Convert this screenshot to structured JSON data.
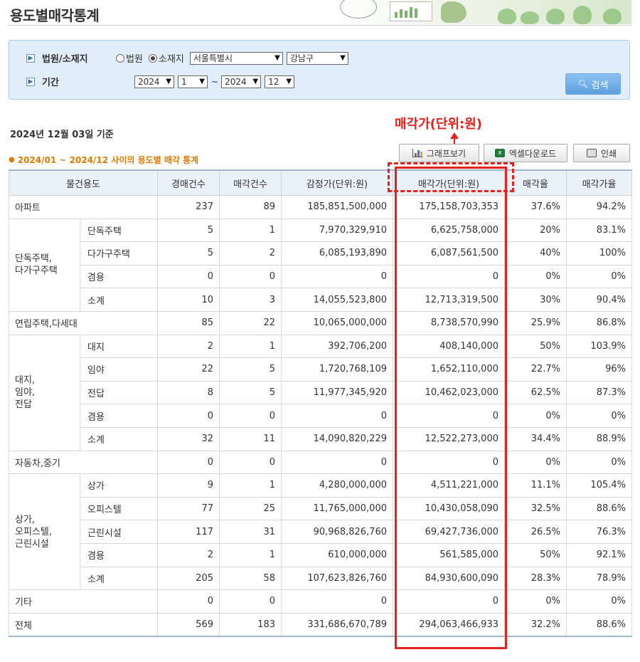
{
  "page": {
    "title": "용도별매각통계"
  },
  "search": {
    "court_label": "법원/소재지",
    "period_label": "기간",
    "radio_court": "법원",
    "radio_location": "소재지",
    "selected_radio": "소재지",
    "city_select": "서울특별시",
    "district_select": "강남구",
    "from_year": "2024",
    "from_month": "1",
    "tilde": "~",
    "to_year": "2024",
    "to_month": "12",
    "search_button": "검색"
  },
  "info": {
    "base_date": "2024년 12월 03일 기준",
    "period_title": "2024/01 ~ 2024/12 사이의 용도별 매각 통계"
  },
  "toolbar": {
    "graph_button": "그래프보기",
    "excel_button": "엑셀다운로드",
    "print_button": "인쇄"
  },
  "annotation": {
    "label": "매각가(단위:원)",
    "color": "#e8201a"
  },
  "table": {
    "headers": [
      "물건용도",
      "경매건수",
      "매각건수",
      "감정가(단위:원)",
      "매각가(단위:원)",
      "매각율",
      "매각가율"
    ],
    "groups": [
      {
        "label": "아파트",
        "rows": [
          {
            "name": "",
            "auctions": "237",
            "sold": "89",
            "appraisal": "185,851,500,000",
            "sale_price": "175,158,703,353",
            "sale_rate": "37.6%",
            "price_rate": "94.2%"
          }
        ]
      },
      {
        "label": "단독주택,\n다가구주택",
        "rows": [
          {
            "name": "단독주택",
            "auctions": "5",
            "sold": "1",
            "appraisal": "7,970,329,910",
            "sale_price": "6,625,758,000",
            "sale_rate": "20%",
            "price_rate": "83.1%"
          },
          {
            "name": "다가구주택",
            "auctions": "5",
            "sold": "2",
            "appraisal": "6,085,193,890",
            "sale_price": "6,087,561,500",
            "sale_rate": "40%",
            "price_rate": "100%"
          },
          {
            "name": "겸용",
            "auctions": "0",
            "sold": "0",
            "appraisal": "0",
            "sale_price": "0",
            "sale_rate": "0%",
            "price_rate": "0%"
          },
          {
            "name": "소계",
            "auctions": "10",
            "sold": "3",
            "appraisal": "14,055,523,800",
            "sale_price": "12,713,319,500",
            "sale_rate": "30%",
            "price_rate": "90.4%"
          }
        ]
      },
      {
        "label": "연립주택,다세대",
        "rows": [
          {
            "name": "",
            "auctions": "85",
            "sold": "22",
            "appraisal": "10,065,000,000",
            "sale_price": "8,738,570,990",
            "sale_rate": "25.9%",
            "price_rate": "86.8%"
          }
        ]
      },
      {
        "label": "대지,\n임야,\n전답",
        "rows": [
          {
            "name": "대지",
            "auctions": "2",
            "sold": "1",
            "appraisal": "392,706,200",
            "sale_price": "408,140,000",
            "sale_rate": "50%",
            "price_rate": "103.9%"
          },
          {
            "name": "임야",
            "auctions": "22",
            "sold": "5",
            "appraisal": "1,720,768,109",
            "sale_price": "1,652,110,000",
            "sale_rate": "22.7%",
            "price_rate": "96%"
          },
          {
            "name": "전답",
            "auctions": "8",
            "sold": "5",
            "appraisal": "11,977,345,920",
            "sale_price": "10,462,023,000",
            "sale_rate": "62.5%",
            "price_rate": "87.3%"
          },
          {
            "name": "겸용",
            "auctions": "0",
            "sold": "0",
            "appraisal": "0",
            "sale_price": "0",
            "sale_rate": "0%",
            "price_rate": "0%"
          },
          {
            "name": "소계",
            "auctions": "32",
            "sold": "11",
            "appraisal": "14,090,820,229",
            "sale_price": "12,522,273,000",
            "sale_rate": "34.4%",
            "price_rate": "88.9%"
          }
        ]
      },
      {
        "label": "자동차,중기",
        "rows": [
          {
            "name": "",
            "auctions": "0",
            "sold": "0",
            "appraisal": "0",
            "sale_price": "0",
            "sale_rate": "0%",
            "price_rate": "0%"
          }
        ]
      },
      {
        "label": "상가,\n오피스텔,\n근린시설",
        "rows": [
          {
            "name": "상가",
            "auctions": "9",
            "sold": "1",
            "appraisal": "4,280,000,000",
            "sale_price": "4,511,221,000",
            "sale_rate": "11.1%",
            "price_rate": "105.4%"
          },
          {
            "name": "오피스텔",
            "auctions": "77",
            "sold": "25",
            "appraisal": "11,765,000,000",
            "sale_price": "10,430,058,090",
            "sale_rate": "32.5%",
            "price_rate": "88.6%"
          },
          {
            "name": "근린시설",
            "auctions": "117",
            "sold": "31",
            "appraisal": "90,968,826,760",
            "sale_price": "69,427,736,000",
            "sale_rate": "26.5%",
            "price_rate": "76.3%"
          },
          {
            "name": "겸용",
            "auctions": "2",
            "sold": "1",
            "appraisal": "610,000,000",
            "sale_price": "561,585,000",
            "sale_rate": "50%",
            "price_rate": "92.1%"
          },
          {
            "name": "소계",
            "auctions": "205",
            "sold": "58",
            "appraisal": "107,623,826,760",
            "sale_price": "84,930,600,090",
            "sale_rate": "28.3%",
            "price_rate": "78.9%"
          }
        ]
      },
      {
        "label": "기타",
        "rows": [
          {
            "name": "",
            "auctions": "0",
            "sold": "0",
            "appraisal": "0",
            "sale_price": "0",
            "sale_rate": "0%",
            "price_rate": "0%"
          }
        ]
      },
      {
        "label": "전체",
        "rows": [
          {
            "name": "",
            "auctions": "569",
            "sold": "183",
            "appraisal": "331,686,670,789",
            "sale_price": "294,063,466,933",
            "sale_rate": "32.2%",
            "price_rate": "88.6%"
          }
        ]
      }
    ]
  },
  "colors": {
    "header_bg": "#e9f1f9",
    "search_bg": "#e1edf9",
    "period_text": "#e07a00",
    "highlight": "#e8201a"
  }
}
